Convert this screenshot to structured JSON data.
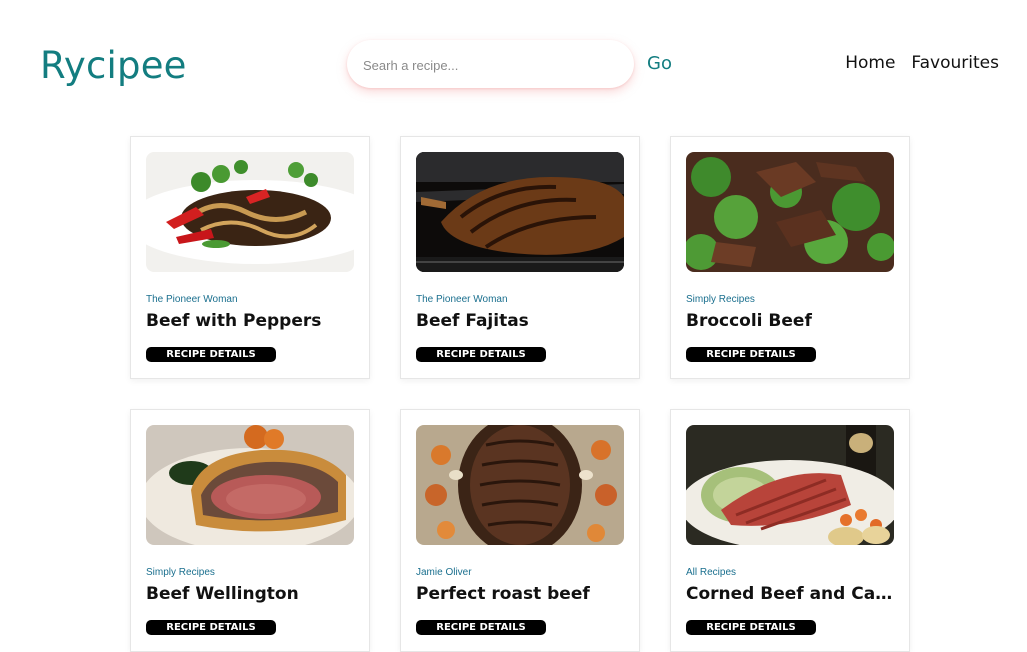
{
  "header": {
    "logo": "Rycipee",
    "search": {
      "placeholder": "Searh a recipe...",
      "value": ""
    },
    "go_label": "Go",
    "nav": [
      "Home",
      "Favourites"
    ]
  },
  "recipes": [
    {
      "source": "The Pioneer Woman",
      "title": "Beef with Peppers",
      "button": "RECIPE DETAILS",
      "image": "beef-with-peppers-photo"
    },
    {
      "source": "The Pioneer Woman",
      "title": "Beef Fajitas",
      "button": "RECIPE DETAILS",
      "image": "grilled-steak-photo"
    },
    {
      "source": "Simply Recipes",
      "title": "Broccoli Beef",
      "button": "RECIPE DETAILS",
      "image": "broccoli-beef-photo"
    },
    {
      "source": "Simply Recipes",
      "title": "Beef Wellington",
      "button": "RECIPE DETAILS",
      "image": "beef-wellington-photo"
    },
    {
      "source": "Jamie Oliver",
      "title": "Perfect roast beef",
      "button": "RECIPE DETAILS",
      "image": "roast-beef-photo"
    },
    {
      "source": "All Recipes",
      "title": "Corned Beef and Cabb...",
      "button": "RECIPE DETAILS",
      "image": "corned-beef-cabbage-photo"
    }
  ]
}
